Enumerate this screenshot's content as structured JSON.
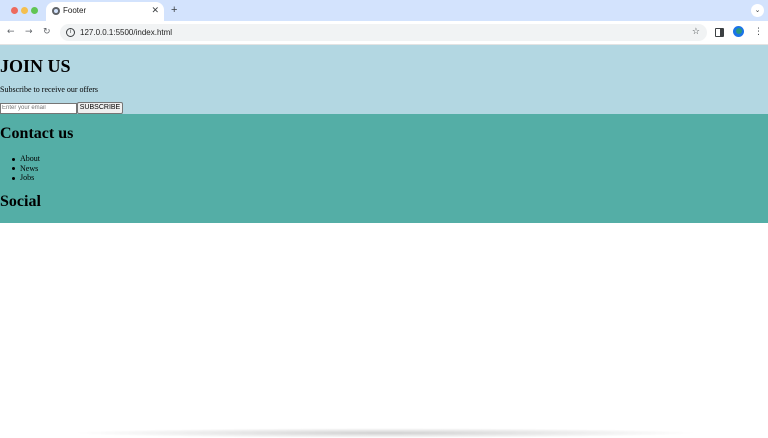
{
  "browser": {
    "tab_title": "Footer",
    "tab_close": "✕",
    "new_tab": "+",
    "tab_menu": "⌄",
    "url": "127.0.0.1:5500/index.html",
    "info": "i",
    "nav_back": "←",
    "nav_forward": "→",
    "nav_reload": "↻",
    "star": "☆",
    "menu": "⋮"
  },
  "join": {
    "heading": "JOIN US",
    "text": "Subscribe to receive our offers",
    "email_placeholder": "Enter your email",
    "subscribe_label": "SUBSCRIBE"
  },
  "contact": {
    "heading": "Contact us",
    "links": [
      "About",
      "News",
      "Jobs"
    ],
    "social_heading": "Social"
  }
}
